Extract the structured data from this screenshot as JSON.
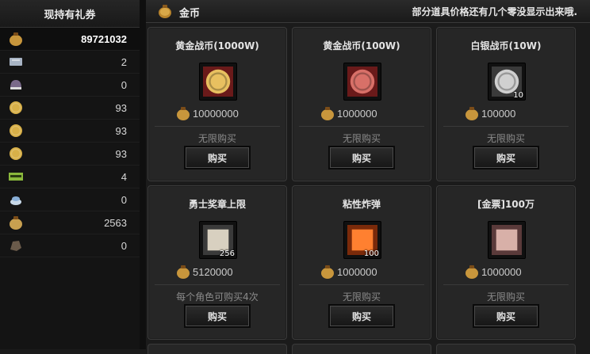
{
  "sidebar": {
    "title": "现持有礼券",
    "rows": [
      {
        "icon": "gold-pouch-icon",
        "value": "89721032",
        "color": "#c8963c"
      },
      {
        "icon": "ticket-icon",
        "value": "2",
        "color": "#a8b4c4"
      },
      {
        "icon": "helmet-icon",
        "value": "0",
        "color": "#7a6a8a"
      },
      {
        "icon": "gold-coin-icon",
        "value": "93",
        "color": "#d8b048"
      },
      {
        "icon": "gold-coin-icon",
        "value": "93",
        "color": "#d8b048"
      },
      {
        "icon": "gold-coin-icon",
        "value": "93",
        "color": "#d8b048"
      },
      {
        "icon": "voucher-icon",
        "value": "4",
        "color": "#8ab83c"
      },
      {
        "icon": "cup-icon",
        "value": "0",
        "color": "#c8d8e8"
      },
      {
        "icon": "gold-bag-icon",
        "value": "2563",
        "color": "#c8a050"
      },
      {
        "icon": "ore-icon",
        "value": "0",
        "color": "#6a5a4a"
      }
    ]
  },
  "header": {
    "icon": "gold-pouch-icon",
    "title": "金币",
    "note": "部分道具价格还有几个零没显示出来哦."
  },
  "items": [
    {
      "name": "黄金战币(1000W)",
      "icon": "gold-coin-icon",
      "qty": "",
      "price": "10000000",
      "limit": "无限购买",
      "buy": "购买",
      "bg": "#6a1a1a",
      "fg": "#e8c060"
    },
    {
      "name": "黄金战币(100W)",
      "icon": "copper-coin-icon",
      "qty": "",
      "price": "1000000",
      "limit": "无限购买",
      "buy": "购买",
      "bg": "#6a1a1a",
      "fg": "#d87068"
    },
    {
      "name": "白银战币(10W)",
      "icon": "silver-coin-icon",
      "qty": "10",
      "price": "100000",
      "limit": "无限购买",
      "buy": "购买",
      "bg": "#3a3a3a",
      "fg": "#d0d0d0"
    },
    {
      "name": "勇士奖章上限",
      "icon": "eagle-medal-icon",
      "qty": "256",
      "price": "5120000",
      "limit": "每个角色可购买4次",
      "buy": "购买",
      "bg": "#3a3a3a",
      "fg": "#d8d0c0"
    },
    {
      "name": "粘性炸弹",
      "icon": "sticky-bomb-icon",
      "qty": "100",
      "price": "1000000",
      "limit": "无限购买",
      "buy": "购买",
      "bg": "#7a2a0a",
      "fg": "#ff8030"
    },
    {
      "name": "[金票]100万",
      "icon": "gold-ticket-icon",
      "qty": "",
      "price": "1000000",
      "limit": "无限购买",
      "buy": "购买",
      "bg": "#5a3a3a",
      "fg": "#d8b0a8"
    }
  ],
  "currency_icon": "gold-pouch-icon"
}
